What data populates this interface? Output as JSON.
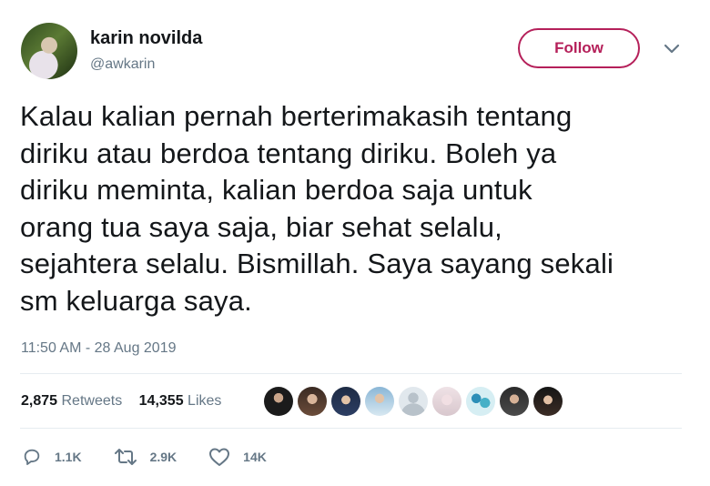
{
  "tweet": {
    "author_name": "karin novilda",
    "author_handle": "@awkarin",
    "follow_label": "Follow",
    "text_lines": [
      "Kalau kalian pernah berterimakasih tentang",
      "diriku atau berdoa tentang diriku. Boleh ya",
      "diriku meminta, kalian berdoa saja untuk",
      "orang tua saya saja, biar sehat selalu,",
      "sejahtera selalu. Bismillah. Saya sayang sekali",
      "sm keluarga saya."
    ],
    "timestamp": "11:50 AM - 28 Aug 2019"
  },
  "stats": {
    "retweets_count": "2,875",
    "retweets_label": "Retweets",
    "likes_count": "14,355",
    "likes_label": "Likes"
  },
  "liker_avatars": [
    "avatar-1",
    "avatar-2",
    "avatar-3",
    "avatar-4",
    "avatar-5",
    "avatar-6",
    "avatar-7",
    "avatar-8",
    "avatar-9"
  ],
  "actions": {
    "replies": "1.1K",
    "retweets": "2.9K",
    "likes": "14K"
  },
  "colors": {
    "follow_accent": "#b5205a",
    "muted": "#657786",
    "text": "#14171a",
    "divider": "#e6ecf0"
  },
  "icons": [
    "chevron-down-icon",
    "reply-icon",
    "retweet-icon",
    "heart-icon"
  ]
}
